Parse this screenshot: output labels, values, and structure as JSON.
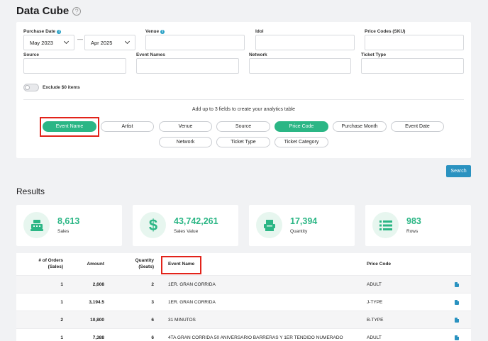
{
  "page": {
    "title": "Data Cube",
    "help_glyph": "?"
  },
  "filters": {
    "purchase_date_label": "Purchase Date",
    "purchase_date_from": "May 2023",
    "date_separator": "—",
    "purchase_date_to": "Apr 2025",
    "venue_label": "Venue",
    "idol_label": "Idol",
    "price_codes_label": "Price Codes (SKU)",
    "source_label": "Source",
    "event_names_label": "Event Names",
    "network_label": "Network",
    "ticket_type_label": "Ticket Type",
    "exclude_zero_label": "Exclude $0 items",
    "exclude_zero_on": false
  },
  "fields": {
    "hint": "Add up to 3 fields to create your analytics table",
    "chips": [
      {
        "label": "Event Name",
        "active": true
      },
      {
        "label": "Artist",
        "active": false
      },
      {
        "label": "Venue",
        "active": false
      },
      {
        "label": "Source",
        "active": false
      },
      {
        "label": "Price Code",
        "active": true
      },
      {
        "label": "Purchase Month",
        "active": false
      },
      {
        "label": "Event Date",
        "active": false
      },
      {
        "label": "Network",
        "active": false
      },
      {
        "label": "Ticket Type",
        "active": false
      },
      {
        "label": "Ticket Category",
        "active": false
      }
    ]
  },
  "search_label": "Search",
  "results": {
    "title": "Results",
    "stats": [
      {
        "value": "8,613",
        "label": "Sales",
        "icon": "cash-register-icon"
      },
      {
        "value": "43,742,261",
        "label": "Sales Value",
        "icon": "dollar-icon"
      },
      {
        "value": "17,394",
        "label": "Quantity",
        "icon": "ticket-machine-icon"
      },
      {
        "value": "983",
        "label": "Rows",
        "icon": "list-icon"
      }
    ]
  },
  "table": {
    "headers": {
      "orders": "# of Orders (Sales)",
      "amount": "Amount",
      "quantity": "Quantity (Seats)",
      "event_name": "Event Name",
      "price_code": "Price Code"
    },
    "rows": [
      {
        "orders": "1",
        "amount": "2,608",
        "quantity": "2",
        "event": "1ER. GRAN CORRIDA",
        "price_code": "ADULT"
      },
      {
        "orders": "1",
        "amount": "3,194.5",
        "quantity": "3",
        "event": "1ER. GRAN CORRIDA",
        "price_code": "J-TYPE"
      },
      {
        "orders": "2",
        "amount": "10,800",
        "quantity": "6",
        "event": "31 MINUTOS",
        "price_code": "B-TYPE"
      },
      {
        "orders": "1",
        "amount": "7,388",
        "quantity": "6",
        "event": "4TA GRAN CORRIDA 50 ANIVERSARIO BARRERAS Y 1ER TENDIDO NUMERADO",
        "price_code": "ADULT"
      }
    ]
  },
  "colors": {
    "accent_green": "#2bb685",
    "accent_blue": "#2a92c0",
    "highlight_red": "#e2231a"
  }
}
